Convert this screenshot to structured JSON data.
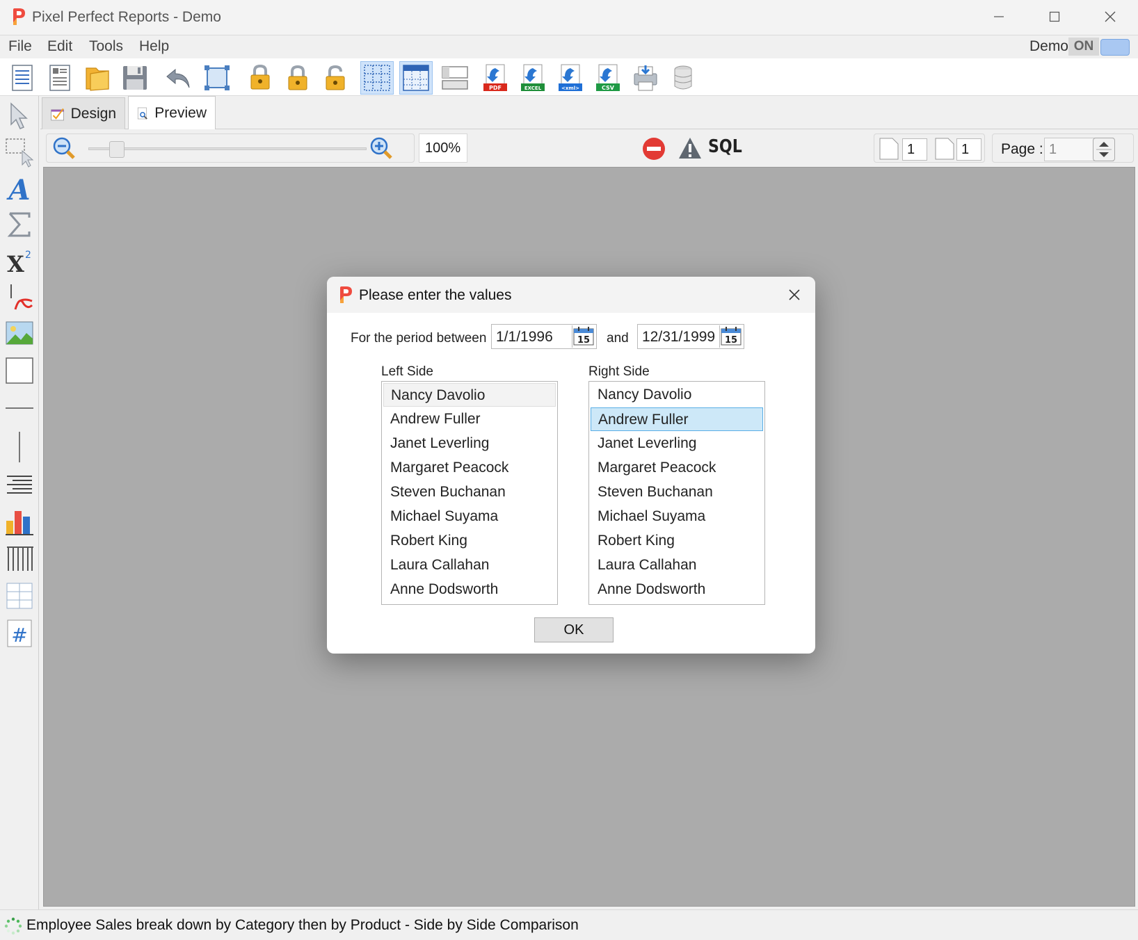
{
  "window": {
    "title": "Pixel Perfect Reports - Demo",
    "controls": [
      "minimize-icon",
      "maximize-icon",
      "close-icon"
    ]
  },
  "menu": {
    "items": [
      "File",
      "Edit",
      "Tools",
      "Help"
    ],
    "demo_label": "Demo",
    "demo_toggle": "ON"
  },
  "toolbar": {
    "icons": [
      "new-report-icon",
      "report-properties-icon",
      "open-folder-icon",
      "save-icon",
      "undo-icon",
      "select-all-icon",
      "lock-position-icon",
      "lock-icon",
      "unlock-icon",
      "grid-icon",
      "snap-grid-icon",
      "band-layout-icon",
      "export-pdf-icon",
      "export-excel-icon",
      "export-xml-icon",
      "export-csv-icon",
      "print-icon",
      "database-icon"
    ],
    "export_labels": {
      "pdf": "PDF",
      "excel": "EXCEL",
      "xml": "<xml>",
      "csv": "CSV"
    }
  },
  "palette": {
    "icons": [
      "pointer-icon",
      "marquee-select-icon",
      "text-icon",
      "sum-icon",
      "formula-icon",
      "pdf-field-icon",
      "image-icon",
      "rectangle-icon",
      "horizontal-line-icon",
      "vertical-line-icon",
      "paragraph-icon",
      "chart-icon",
      "table-icon",
      "grid-table-icon",
      "page-number-icon"
    ]
  },
  "tabs": [
    {
      "label": "Design",
      "active": false
    },
    {
      "label": "Preview",
      "active": true
    }
  ],
  "preview_toolbar": {
    "zoom_value": "100%",
    "zoom_level": 0.1,
    "sql_label": "SQL",
    "page_from": "1",
    "page_to": "1",
    "page_label": "Page :",
    "page_value": "1"
  },
  "dialog": {
    "title": "Please enter the values",
    "period_label": "For the period between",
    "start_date": "1/1/1996",
    "and_label": "and",
    "end_date": "12/31/1999",
    "calendar_day": "15",
    "left": {
      "label": "Left Side",
      "items": [
        "Nancy Davolio",
        "Andrew Fuller",
        "Janet Leverling",
        "Margaret Peacock",
        "Steven Buchanan",
        "Michael Suyama",
        "Robert King",
        "Laura Callahan",
        "Anne Dodsworth"
      ],
      "focused": "Nancy Davolio"
    },
    "right": {
      "label": "Right Side",
      "items": [
        "Nancy Davolio",
        "Andrew Fuller",
        "Janet Leverling",
        "Margaret Peacock",
        "Steven Buchanan",
        "Michael Suyama",
        "Robert King",
        "Laura Callahan",
        "Anne Dodsworth"
      ],
      "selected": "Andrew Fuller"
    },
    "ok_label": "OK"
  },
  "status": {
    "text": "Employee Sales break down by Category then by Product - Side by Side Comparison"
  },
  "colors": {
    "canvas": "#ababab",
    "selection": "#cde8f8",
    "brand": "#e8453c"
  }
}
